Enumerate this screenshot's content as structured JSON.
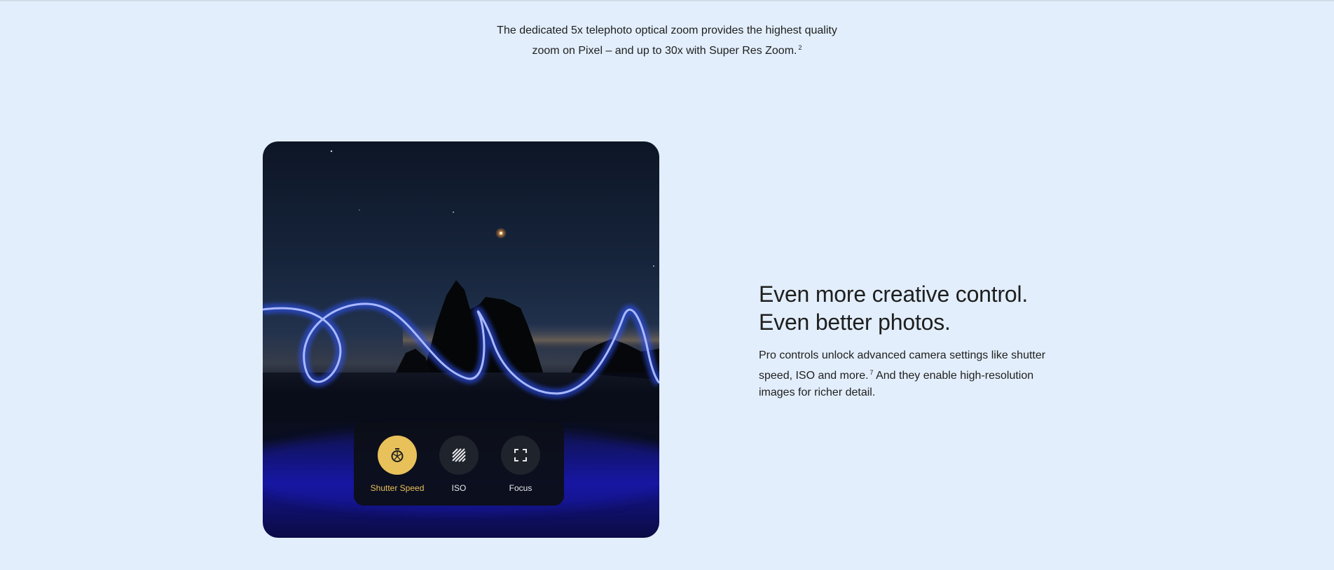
{
  "zoom_caption": {
    "line1": "The dedicated 5x telephoto optical zoom provides the highest quality",
    "line2": "zoom on Pixel – and up to 30x with Super Res Zoom.",
    "footnote": "2"
  },
  "pro_controls": {
    "headline_line1": "Even more creative control.",
    "headline_line2": "Even better photos.",
    "body_part1": "Pro controls unlock advanced camera settings like shutter speed, ISO and more.",
    "footnote": "7",
    "body_part2": " And they enable high-resolution images for richer detail."
  },
  "camera_controls": [
    {
      "label": "Shutter Speed",
      "icon": "stopwatch-icon",
      "active": true
    },
    {
      "label": "ISO",
      "icon": "iso-stripes-icon",
      "active": false
    },
    {
      "label": "Focus",
      "icon": "focus-frame-icon",
      "active": false
    }
  ],
  "colors": {
    "page_background": "#e2eefb",
    "accent_active": "#e8c15b",
    "text": "#1f1f1f"
  }
}
